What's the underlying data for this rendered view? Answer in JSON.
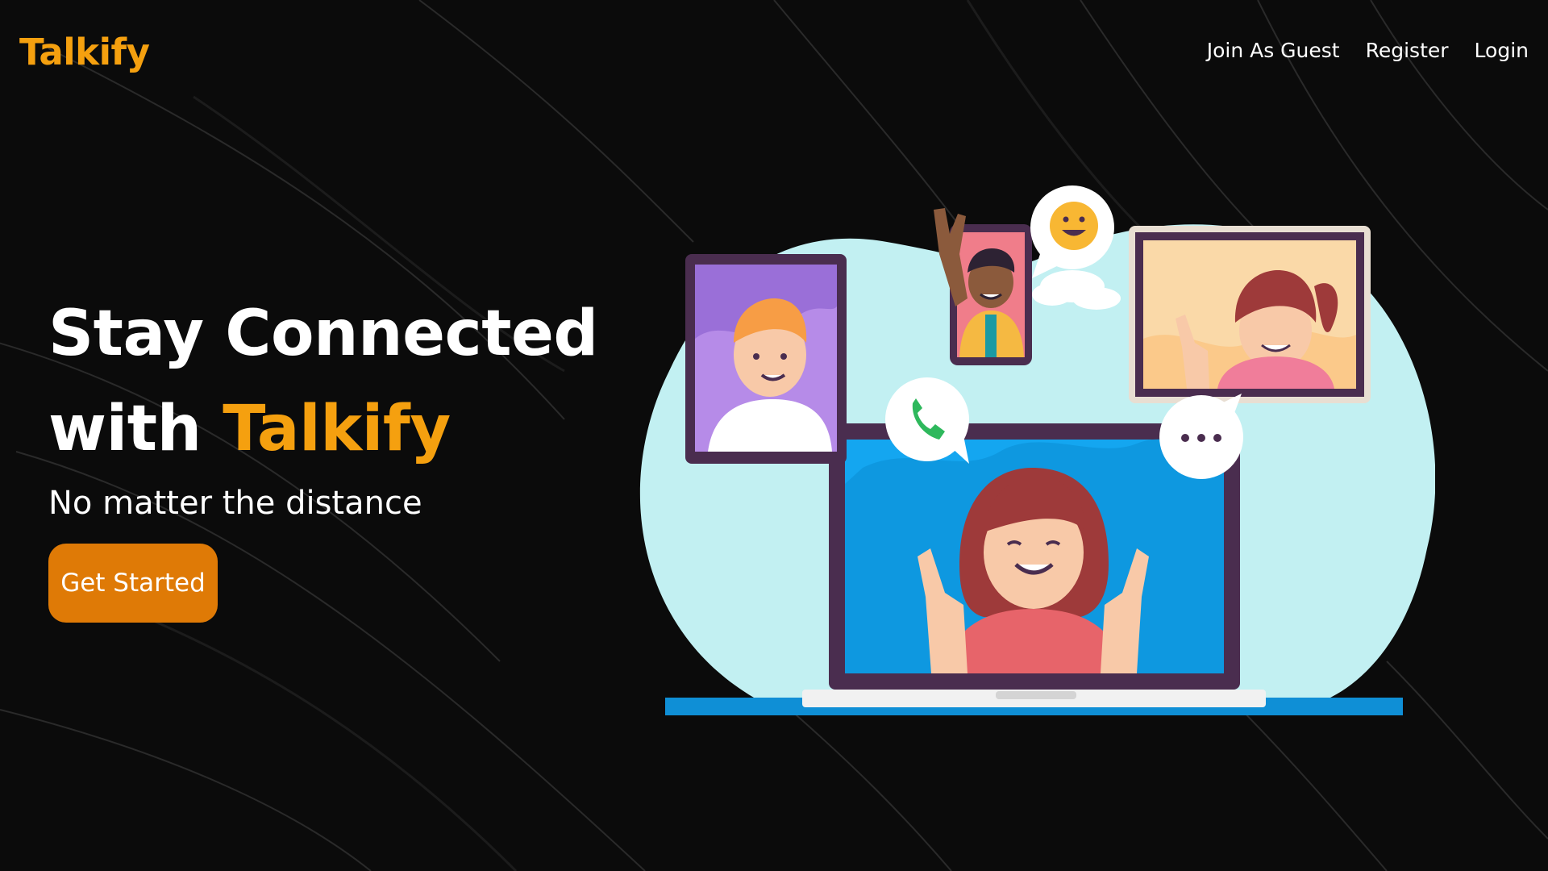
{
  "navbar": {
    "brand": "Talkify",
    "links": [
      {
        "label": "Join As Guest"
      },
      {
        "label": "Register"
      },
      {
        "label": "Login"
      }
    ]
  },
  "hero": {
    "title_line1": "Stay Connected",
    "title_line2_prefix": "with ",
    "title_line2_accent": "Talkify",
    "subtitle": "No matter the distance",
    "cta_label": "Get Started"
  },
  "illustration": {
    "icons": [
      "smiley-emoji-icon",
      "phone-icon",
      "ellipsis-icon",
      "peace-hand-icon"
    ]
  },
  "colors": {
    "accent": "#f5a00f",
    "cta": "#df7a06",
    "background": "#0b0b0b",
    "text": "#ffffff",
    "blob": "#c2f0f2",
    "laptop_screen": "#14a6f0"
  }
}
